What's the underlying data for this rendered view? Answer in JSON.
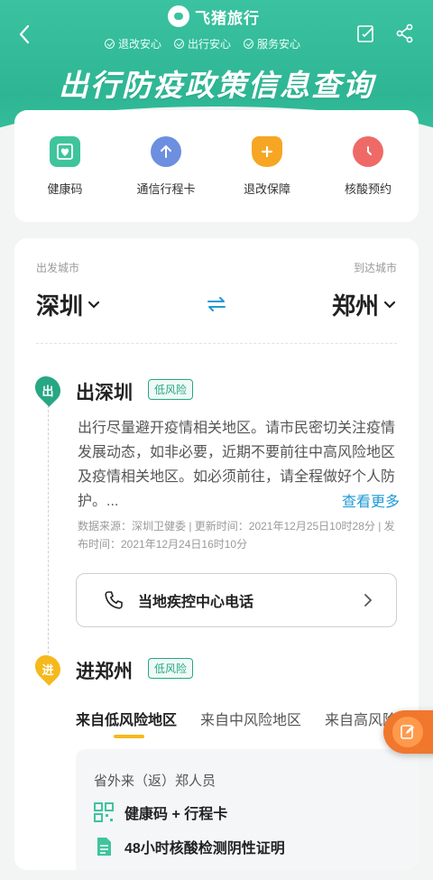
{
  "header": {
    "brand": "飞猪旅行",
    "guarantees": [
      "退改安心",
      "出行安心",
      "服务安心"
    ],
    "title": "出行防疫政策信息查询"
  },
  "services": [
    {
      "label": "健康码",
      "icon": "health-code-icon",
      "color": "#3fc49c"
    },
    {
      "label": "通信行程卡",
      "icon": "arrow-up-icon",
      "color": "#6d8fe0"
    },
    {
      "label": "退改保障",
      "icon": "shield-icon",
      "color": "#f6a623"
    },
    {
      "label": "核酸预约",
      "icon": "clock-icon",
      "color": "#ef6a67"
    }
  ],
  "route": {
    "from_label": "出发城市",
    "to_label": "到达城市",
    "from_city": "深圳",
    "to_city": "郑州"
  },
  "departure": {
    "marker": "出",
    "title": "出深圳",
    "risk": "低风险",
    "policy": "出行尽量避开疫情相关地区。请市民密切关注疫情发展动态，如非必要，近期不要前往中高风险地区及疫情相关地区。如必须前往，请全程做好个人防护。...",
    "see_more": "查看更多",
    "source": "数据来源：深圳卫健委 | 更新时间：2021年12月25日10时28分 | 发布时间：2021年12月24日16时10分",
    "phone_label": "当地疾控中心电话"
  },
  "arrival": {
    "marker": "进",
    "title": "进郑州",
    "risk": "低风险",
    "tabs": [
      "来自低风险地区",
      "来自中风险地区",
      "来自高风险地区"
    ],
    "active_tab": 0,
    "requirements_title": "省外来（返）郑人员",
    "requirements": [
      {
        "icon": "qr-code-icon",
        "text": "健康码 + 行程卡"
      },
      {
        "icon": "document-icon",
        "text": "48小时核酸检测阴性证明"
      }
    ]
  },
  "colors": {
    "brand": "#2eb694",
    "accent_blue": "#1f9ad6",
    "tab_underline": "#f5b91d",
    "float_button": "#f0772c",
    "departure_marker": "#27a784",
    "arrival_marker": "#f5b91d"
  }
}
